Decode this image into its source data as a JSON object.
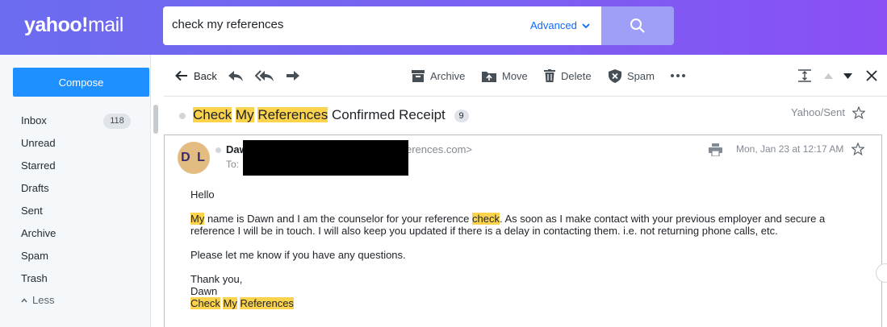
{
  "header": {
    "logo": {
      "brand": "yahoo!",
      "product": "mail"
    },
    "search": {
      "value": "check my references",
      "advanced_label": "Advanced"
    },
    "icons": {
      "search": "search-icon",
      "advanced": "chevron-down-icon"
    }
  },
  "sidebar": {
    "compose_label": "Compose",
    "folders": [
      {
        "label": "Inbox",
        "count": "118"
      },
      {
        "label": "Unread"
      },
      {
        "label": "Starred"
      },
      {
        "label": "Drafts"
      },
      {
        "label": "Sent"
      },
      {
        "label": "Archive"
      },
      {
        "label": "Spam"
      },
      {
        "label": "Trash"
      }
    ],
    "less_label": "Less"
  },
  "toolbar": {
    "back_label": "Back",
    "archive_label": "Archive",
    "move_label": "Move",
    "delete_label": "Delete",
    "spam_label": "Spam"
  },
  "thread": {
    "subject_highlighted": [
      "Check",
      "My",
      "References"
    ],
    "subject_rest": "Confirmed Receipt",
    "count": "9",
    "folder": "Yahoo/Sent"
  },
  "message": {
    "avatar_initials": "D L",
    "sender_partial": "Daw",
    "sender_email_partial": "erences.com>",
    "to_label": "To:",
    "date": "Mon, Jan 23 at 12:17 AM",
    "body": {
      "greeting": "Hello",
      "p1_w1": "My",
      "p1_t1": " name is Dawn and I am the counselor for your reference ",
      "p1_w2": "check",
      "p1_t2": ". As soon as I make contact with your previous employer and secure a reference I will be in touch. I will also keep you updated if there is a delay in contacting them. i.e. not returning phone calls, etc.",
      "p2": "Please let me know if you have any questions.",
      "closing": "Thank you,",
      "name": "Dawn",
      "signature": [
        "Check",
        "My",
        "References"
      ]
    }
  },
  "colors": {
    "accent": "#1e90ff",
    "highlight": "#fcd34d",
    "header_from": "#6c6cf0",
    "header_to": "#8a4ff4"
  }
}
